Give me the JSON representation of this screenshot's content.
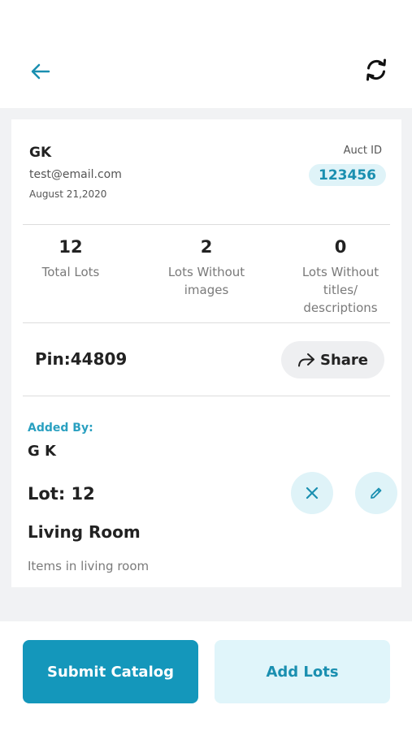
{
  "header": {
    "back_icon": "arrow-left-icon",
    "refresh_icon": "refresh-icon",
    "accent_color": "#1a8fb0"
  },
  "user": {
    "name": "GK",
    "email": "test@email.com",
    "date": "August 21,2020"
  },
  "auction": {
    "label": "Auct ID",
    "id": "123456"
  },
  "stats": [
    {
      "value": "12",
      "label": "Total Lots"
    },
    {
      "value": "2",
      "label": "Lots Without images"
    },
    {
      "value": "0",
      "label": "Lots Without titles/ descriptions"
    }
  ],
  "pin": {
    "text": "Pin:44809"
  },
  "share": {
    "label": "Share",
    "icon": "share-icon"
  },
  "lot": {
    "added_by_label": "Added By:",
    "added_by_name": "G K",
    "lot_label": "Lot: 12",
    "title": "Living Room",
    "description": "Items in living room",
    "delete_icon": "close-icon",
    "edit_icon": "pencil-icon"
  },
  "footer": {
    "submit_label": "Submit Catalog",
    "add_label": "Add Lots",
    "primary_color": "#1497bb",
    "secondary_color": "#e0f5fa"
  }
}
